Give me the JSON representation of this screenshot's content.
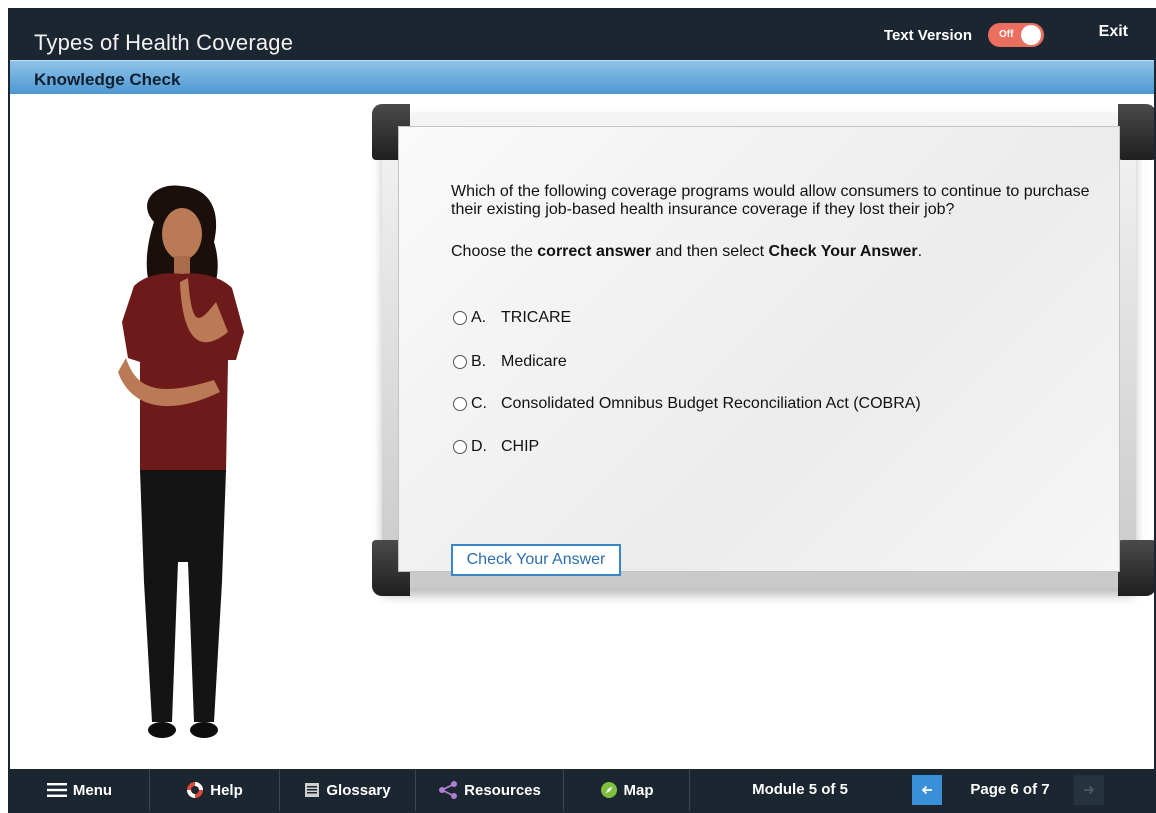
{
  "header": {
    "course_title": "Types of Health Coverage",
    "text_version_label": "Text Version",
    "toggle_state": "Off",
    "exit_label": "Exit"
  },
  "subheader": {
    "title": "Knowledge Check"
  },
  "question": {
    "text": "Which of the following coverage programs would allow consumers to continue to purchase their existing job-based health insurance coverage if they lost their job?",
    "instruction_prefix": "Choose the ",
    "instruction_bold1": "correct answer",
    "instruction_middle": " and then select ",
    "instruction_bold2": "Check Your Answer",
    "instruction_suffix": ".",
    "options": [
      {
        "letter": "A.",
        "label": "TRICARE"
      },
      {
        "letter": "B.",
        "label": "Medicare"
      },
      {
        "letter": "C.",
        "label": "Consolidated Omnibus Budget Reconciliation Act (COBRA)"
      },
      {
        "letter": "D.",
        "label": "CHIP"
      }
    ],
    "check_button_label": "Check Your Answer"
  },
  "nav": {
    "menu_label": "Menu",
    "help_label": "Help",
    "glossary_label": "Glossary",
    "resources_label": "Resources",
    "map_label": "Map",
    "module_label": "Module 5 of 5",
    "page_label": "Page 6 of 7"
  },
  "colors": {
    "header_bg": "#1c2630",
    "subbar_blue": "#4c97d2",
    "toggle_off": "#ec6e5f",
    "accent": "#3a8fd9"
  }
}
